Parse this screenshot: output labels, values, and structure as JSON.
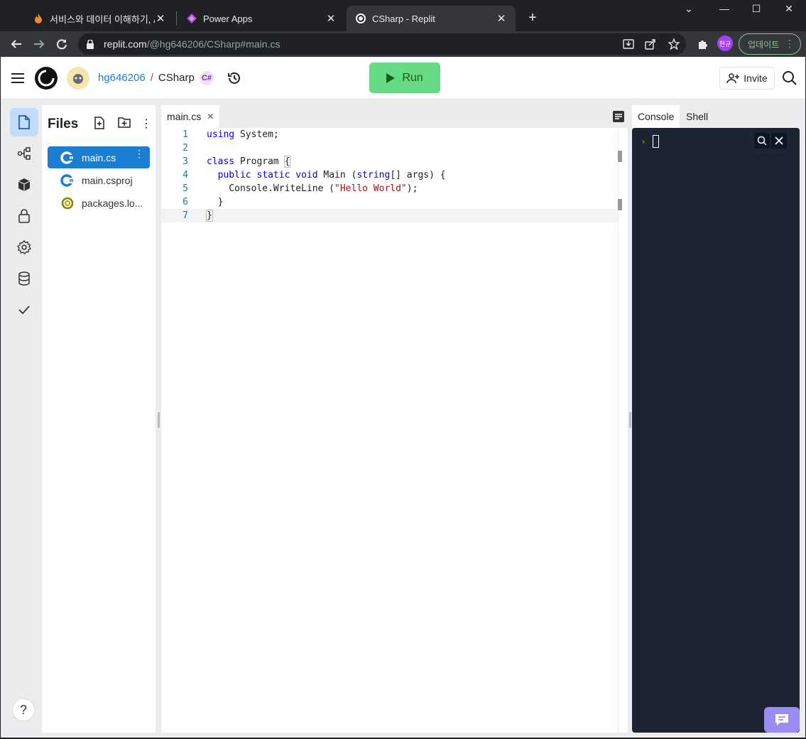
{
  "browser": {
    "tabs": [
      {
        "title": "서비스와 데이터 이해하기, A",
        "favicon": "flame-icon"
      },
      {
        "title": "Power Apps",
        "favicon": "power-apps-icon"
      },
      {
        "title": "CSharp - Replit",
        "favicon": "replit-icon",
        "active": true
      }
    ],
    "url_host": "replit.com",
    "url_path": "/@hg646206/CSharp#main.cs",
    "profile_label": "현규",
    "update_label": "업데이트"
  },
  "header": {
    "username": "hg646206",
    "separator": "/",
    "repl_name": "CSharp",
    "lang_badge": "C#",
    "run_label": "Run",
    "invite_label": "Invite"
  },
  "files": {
    "title": "Files",
    "items": [
      {
        "name": "main.cs",
        "icon": "csharp-icon",
        "active": true
      },
      {
        "name": "main.csproj",
        "icon": "csharp-icon"
      },
      {
        "name": "packages.lo...",
        "icon": "nuget-icon"
      }
    ]
  },
  "editor": {
    "tab_label": "main.cs",
    "line_numbers": [
      "1",
      "2",
      "3",
      "4",
      "5",
      "6",
      "7"
    ],
    "cursor_line": 7
  },
  "console": {
    "tabs": [
      "Console",
      "Shell"
    ],
    "active_tab": "Console",
    "prompt": "›"
  },
  "colors": {
    "run_button": "#68d984",
    "accent": "#1a7ed2",
    "console_bg": "#1c2333",
    "chat_button": "#9b8cf2"
  }
}
